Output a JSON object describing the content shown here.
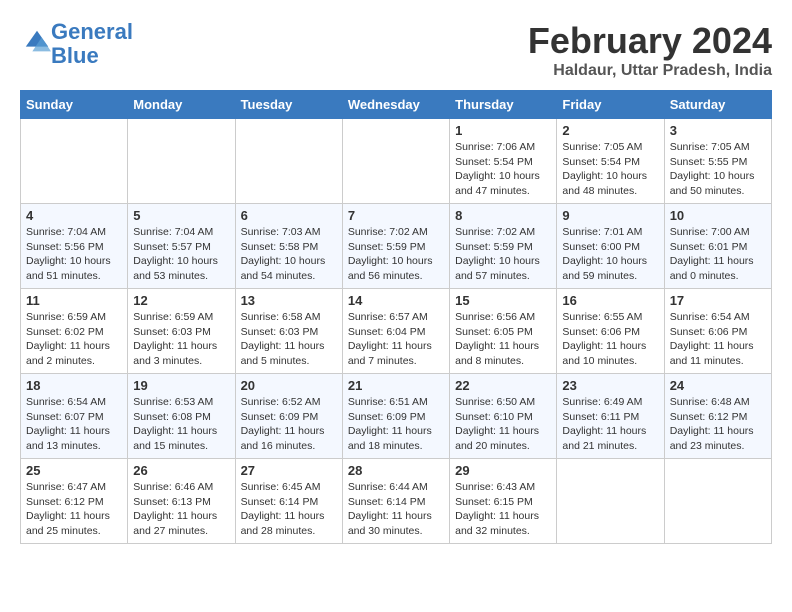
{
  "logo": {
    "line1": "General",
    "line2": "Blue"
  },
  "title": "February 2024",
  "location": "Haldaur, Uttar Pradesh, India",
  "headers": [
    "Sunday",
    "Monday",
    "Tuesday",
    "Wednesday",
    "Thursday",
    "Friday",
    "Saturday"
  ],
  "weeks": [
    [
      {
        "day": "",
        "content": ""
      },
      {
        "day": "",
        "content": ""
      },
      {
        "day": "",
        "content": ""
      },
      {
        "day": "",
        "content": ""
      },
      {
        "day": "1",
        "content": "Sunrise: 7:06 AM\nSunset: 5:54 PM\nDaylight: 10 hours\nand 47 minutes."
      },
      {
        "day": "2",
        "content": "Sunrise: 7:05 AM\nSunset: 5:54 PM\nDaylight: 10 hours\nand 48 minutes."
      },
      {
        "day": "3",
        "content": "Sunrise: 7:05 AM\nSunset: 5:55 PM\nDaylight: 10 hours\nand 50 minutes."
      }
    ],
    [
      {
        "day": "4",
        "content": "Sunrise: 7:04 AM\nSunset: 5:56 PM\nDaylight: 10 hours\nand 51 minutes."
      },
      {
        "day": "5",
        "content": "Sunrise: 7:04 AM\nSunset: 5:57 PM\nDaylight: 10 hours\nand 53 minutes."
      },
      {
        "day": "6",
        "content": "Sunrise: 7:03 AM\nSunset: 5:58 PM\nDaylight: 10 hours\nand 54 minutes."
      },
      {
        "day": "7",
        "content": "Sunrise: 7:02 AM\nSunset: 5:59 PM\nDaylight: 10 hours\nand 56 minutes."
      },
      {
        "day": "8",
        "content": "Sunrise: 7:02 AM\nSunset: 5:59 PM\nDaylight: 10 hours\nand 57 minutes."
      },
      {
        "day": "9",
        "content": "Sunrise: 7:01 AM\nSunset: 6:00 PM\nDaylight: 10 hours\nand 59 minutes."
      },
      {
        "day": "10",
        "content": "Sunrise: 7:00 AM\nSunset: 6:01 PM\nDaylight: 11 hours\nand 0 minutes."
      }
    ],
    [
      {
        "day": "11",
        "content": "Sunrise: 6:59 AM\nSunset: 6:02 PM\nDaylight: 11 hours\nand 2 minutes."
      },
      {
        "day": "12",
        "content": "Sunrise: 6:59 AM\nSunset: 6:03 PM\nDaylight: 11 hours\nand 3 minutes."
      },
      {
        "day": "13",
        "content": "Sunrise: 6:58 AM\nSunset: 6:03 PM\nDaylight: 11 hours\nand 5 minutes."
      },
      {
        "day": "14",
        "content": "Sunrise: 6:57 AM\nSunset: 6:04 PM\nDaylight: 11 hours\nand 7 minutes."
      },
      {
        "day": "15",
        "content": "Sunrise: 6:56 AM\nSunset: 6:05 PM\nDaylight: 11 hours\nand 8 minutes."
      },
      {
        "day": "16",
        "content": "Sunrise: 6:55 AM\nSunset: 6:06 PM\nDaylight: 11 hours\nand 10 minutes."
      },
      {
        "day": "17",
        "content": "Sunrise: 6:54 AM\nSunset: 6:06 PM\nDaylight: 11 hours\nand 11 minutes."
      }
    ],
    [
      {
        "day": "18",
        "content": "Sunrise: 6:54 AM\nSunset: 6:07 PM\nDaylight: 11 hours\nand 13 minutes."
      },
      {
        "day": "19",
        "content": "Sunrise: 6:53 AM\nSunset: 6:08 PM\nDaylight: 11 hours\nand 15 minutes."
      },
      {
        "day": "20",
        "content": "Sunrise: 6:52 AM\nSunset: 6:09 PM\nDaylight: 11 hours\nand 16 minutes."
      },
      {
        "day": "21",
        "content": "Sunrise: 6:51 AM\nSunset: 6:09 PM\nDaylight: 11 hours\nand 18 minutes."
      },
      {
        "day": "22",
        "content": "Sunrise: 6:50 AM\nSunset: 6:10 PM\nDaylight: 11 hours\nand 20 minutes."
      },
      {
        "day": "23",
        "content": "Sunrise: 6:49 AM\nSunset: 6:11 PM\nDaylight: 11 hours\nand 21 minutes."
      },
      {
        "day": "24",
        "content": "Sunrise: 6:48 AM\nSunset: 6:12 PM\nDaylight: 11 hours\nand 23 minutes."
      }
    ],
    [
      {
        "day": "25",
        "content": "Sunrise: 6:47 AM\nSunset: 6:12 PM\nDaylight: 11 hours\nand 25 minutes."
      },
      {
        "day": "26",
        "content": "Sunrise: 6:46 AM\nSunset: 6:13 PM\nDaylight: 11 hours\nand 27 minutes."
      },
      {
        "day": "27",
        "content": "Sunrise: 6:45 AM\nSunset: 6:14 PM\nDaylight: 11 hours\nand 28 minutes."
      },
      {
        "day": "28",
        "content": "Sunrise: 6:44 AM\nSunset: 6:14 PM\nDaylight: 11 hours\nand 30 minutes."
      },
      {
        "day": "29",
        "content": "Sunrise: 6:43 AM\nSunset: 6:15 PM\nDaylight: 11 hours\nand 32 minutes."
      },
      {
        "day": "",
        "content": ""
      },
      {
        "day": "",
        "content": ""
      }
    ]
  ]
}
